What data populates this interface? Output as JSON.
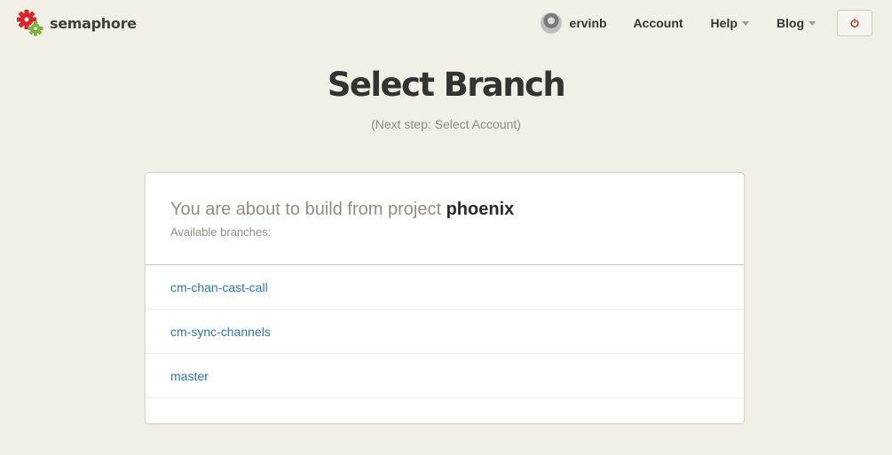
{
  "brand": {
    "name": "semaphore",
    "logo_icon": "semaphore-gears-logo",
    "logo_colors": [
      "#d7262b",
      "#7cb342"
    ]
  },
  "nav": {
    "username": "ervinb",
    "avatar_icon": "user-avatar",
    "account_label": "Account",
    "help_label": "Help",
    "blog_label": "Blog",
    "logout_icon": "power-icon",
    "logout_color": "#b32a20"
  },
  "page": {
    "title": "Select Branch",
    "subtitle": "(Next step: Select Account)"
  },
  "panel": {
    "build_prefix": "You are about to build from project ",
    "project_name": "phoenix",
    "available_label": "Available branches:",
    "branches": [
      {
        "name": "cm-chan-cast-call"
      },
      {
        "name": "cm-sync-channels"
      },
      {
        "name": "master"
      }
    ]
  },
  "colors": {
    "background": "#f2f0e6",
    "link": "#2a76b8",
    "muted_text": "#948d7c"
  }
}
